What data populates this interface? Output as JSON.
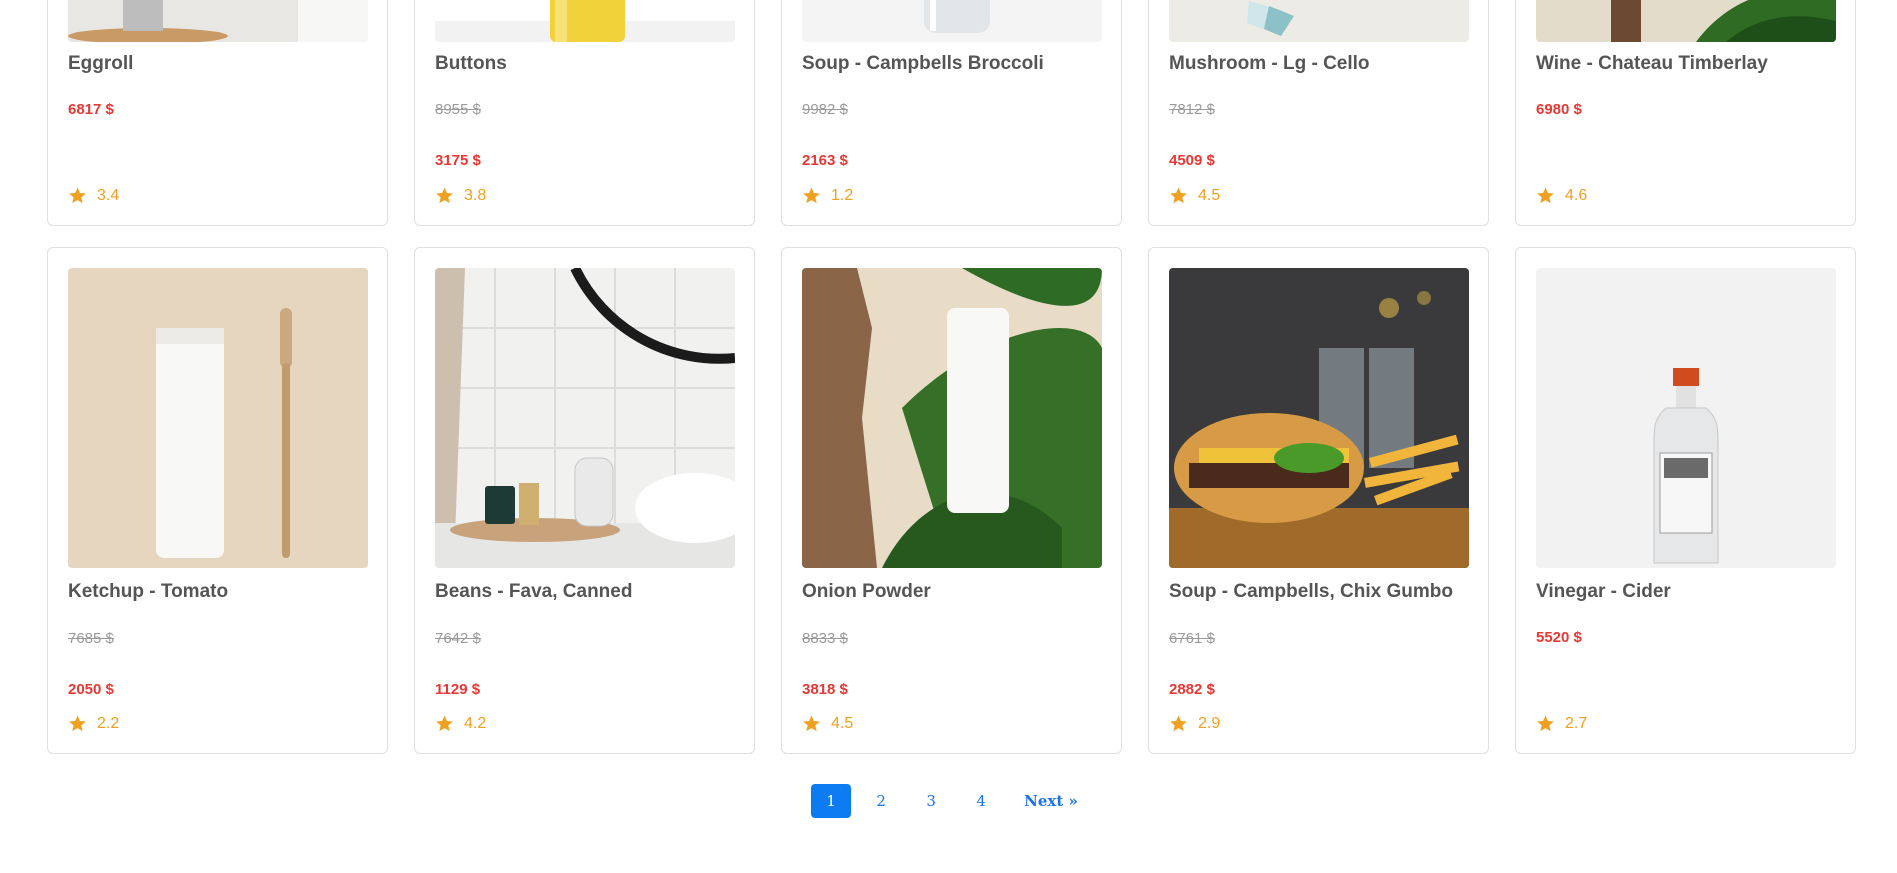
{
  "products_row1": [
    {
      "name": "Eggroll",
      "old_price": "",
      "price": "6817 $",
      "rating": "3.4"
    },
    {
      "name": "Buttons",
      "old_price": "8955 $",
      "price": "3175 $",
      "rating": "3.8"
    },
    {
      "name": "Soup - Campbells Broccoli",
      "old_price": "9982 $",
      "price": "2163 $",
      "rating": "1.2"
    },
    {
      "name": "Mushroom - Lg - Cello",
      "old_price": "7812 $",
      "price": "4509 $",
      "rating": "4.5"
    },
    {
      "name": "Wine - Chateau Timberlay",
      "old_price": "",
      "price": "6980 $",
      "rating": "4.6"
    }
  ],
  "products_row2": [
    {
      "name": "Ketchup - Tomato",
      "old_price": "7685 $",
      "price": "2050 $",
      "rating": "2.2"
    },
    {
      "name": "Beans - Fava, Canned",
      "old_price": "7642 $",
      "price": "1129 $",
      "rating": "4.2"
    },
    {
      "name": "Onion Powder",
      "old_price": "8833 $",
      "price": "3818 $",
      "rating": "4.5"
    },
    {
      "name": "Soup - Campbells, Chix Gumbo",
      "old_price": "6761 $",
      "price": "2882 $",
      "rating": "2.9"
    },
    {
      "name": "Vinegar - Cider",
      "old_price": "",
      "price": "5520 $",
      "rating": "2.7"
    }
  ],
  "pagination": {
    "pages": [
      "1",
      "2",
      "3",
      "4"
    ],
    "active": "1",
    "next_label": "Next »"
  },
  "colors": {
    "price": "#e53935",
    "old_price": "#9a9a9a",
    "rating": "#f0a020",
    "accent": "#0d7cf2"
  },
  "icons": {
    "rating": "star-icon"
  }
}
